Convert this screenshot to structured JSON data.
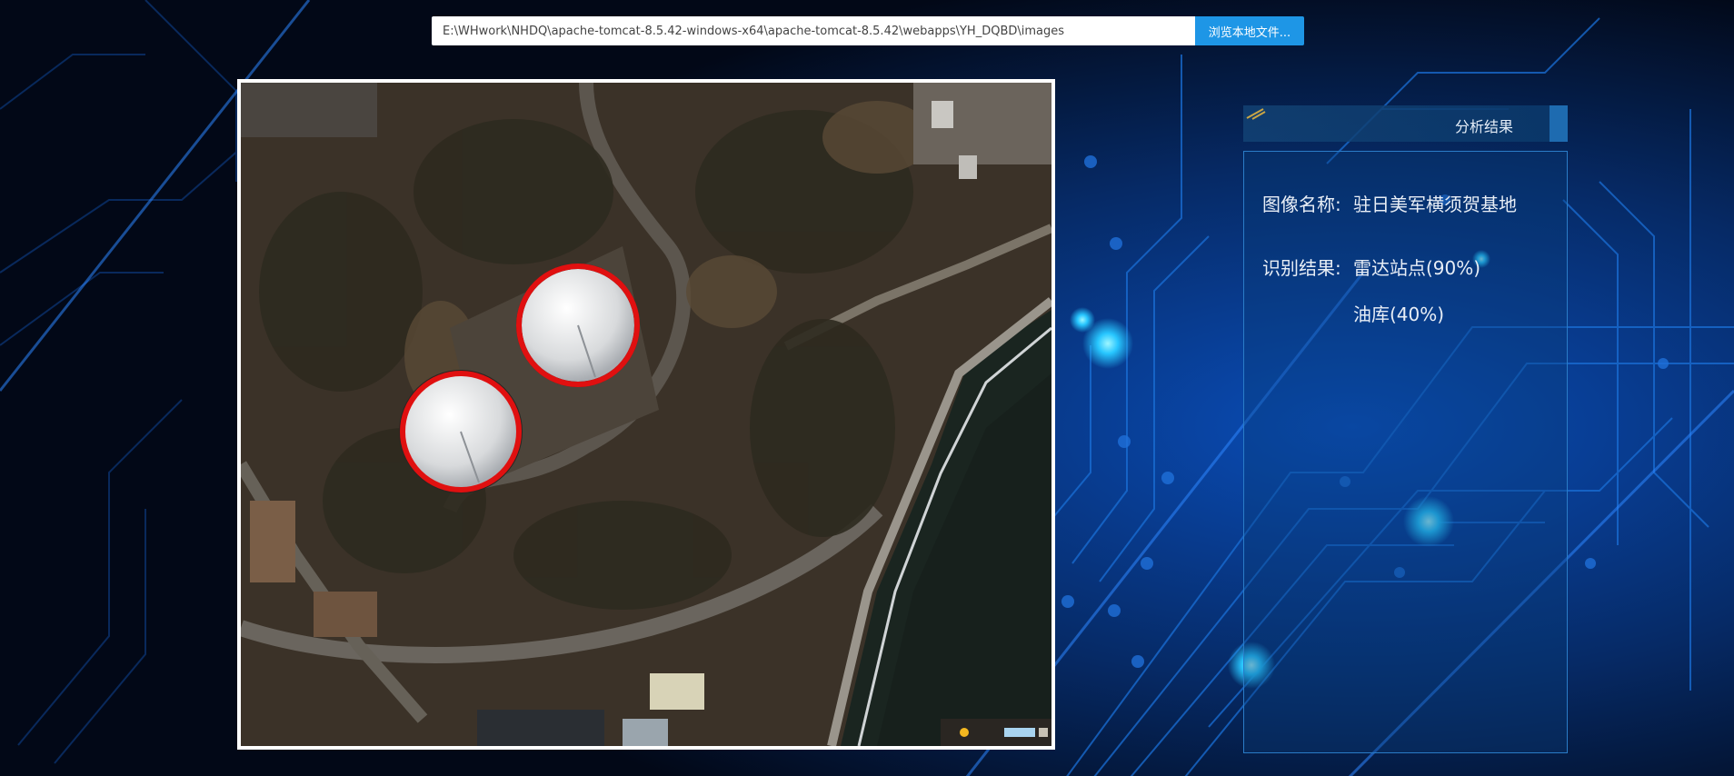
{
  "path_bar": {
    "value": "E:\\WHwork\\NHDQ\\apache-tomcat-8.5.42-windows-x64\\apache-tomcat-8.5.42\\webapps\\YH_DQBD\\images",
    "browse_label": "浏览本地文件..."
  },
  "result_panel": {
    "title": "分析结果",
    "image_name_label": "图像名称:",
    "image_name_value": "驻日美军横须贺基地",
    "result_label": "识别结果:",
    "results": [
      "雷达站点(90%)",
      "油库(40%)"
    ]
  },
  "colors": {
    "accent_blue": "#1e96e6",
    "panel_border": "#2a7cc7",
    "detection_ring": "#e01010"
  }
}
